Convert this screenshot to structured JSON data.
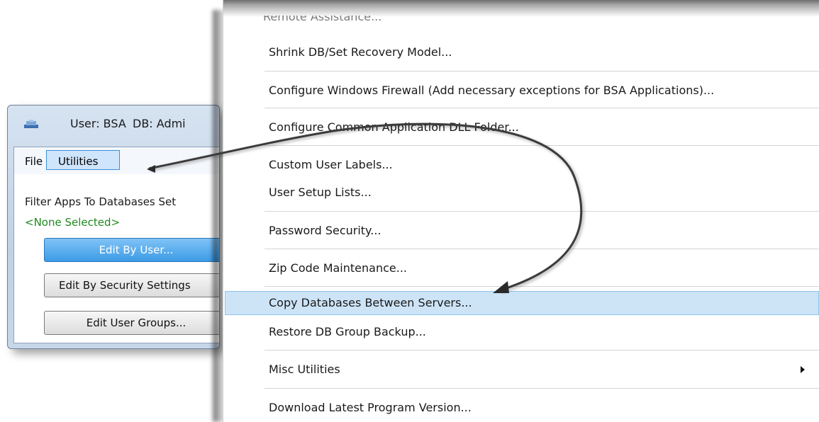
{
  "window": {
    "title_user": "User: BSA",
    "title_db": "DB: Admi",
    "menubar": {
      "file": "File",
      "utilities": "Utilities"
    },
    "filter_label": "Filter Apps To Databases Set",
    "none_selected": "<None Selected>",
    "buttons": {
      "edit_by_user": "Edit By User...",
      "edit_by_security": "Edit By Security Settings",
      "edit_user_groups": "Edit User Groups..."
    }
  },
  "menu": {
    "partial_top": "Remote Assistance...",
    "items": [
      "Shrink DB/Set Recovery Model...",
      "Configure Windows Firewall (Add necessary exceptions for BSA Applications)...",
      "Configure Common Application DLL Folder...",
      "Custom User Labels...",
      "User Setup Lists...",
      "Password Security...",
      "Zip Code Maintenance...",
      "Copy Databases Between Servers...",
      "Restore DB Group Backup...",
      "Misc Utilities",
      "Download Latest Program Version..."
    ],
    "highlighted_item": "Copy Databases Between Servers..."
  },
  "colors": {
    "highlight_bg": "#cde4f7",
    "highlight_border": "#8ec3ec",
    "none_selected_green": "#1f8a1f",
    "primary_button": "#3d9be6"
  }
}
